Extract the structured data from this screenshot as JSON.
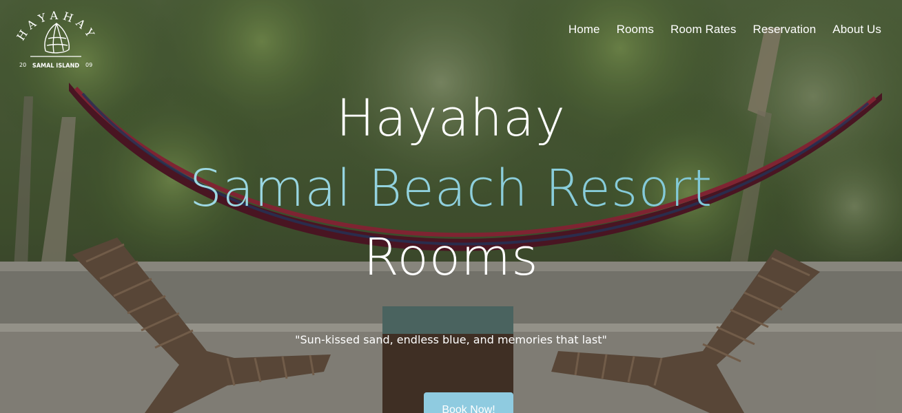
{
  "logo": {
    "top_text": "HAYAHAY",
    "bottom_text": "SAMAL ISLAND",
    "year_left": "20",
    "year_right": "09"
  },
  "nav": {
    "items": [
      {
        "label": "Home"
      },
      {
        "label": "Rooms"
      },
      {
        "label": "Room Rates"
      },
      {
        "label": "Reservation"
      },
      {
        "label": "About Us"
      }
    ]
  },
  "hero": {
    "line1": "Hayahay",
    "line2": "Samal Beach Resort",
    "line3": "Rooms",
    "tagline": "\"Sun-kissed sand, endless blue, and memories that last\"",
    "cta_label": "Book Now!"
  },
  "colors": {
    "accent": "#8fcbe0",
    "heading_accent": "#8fd0dd"
  }
}
